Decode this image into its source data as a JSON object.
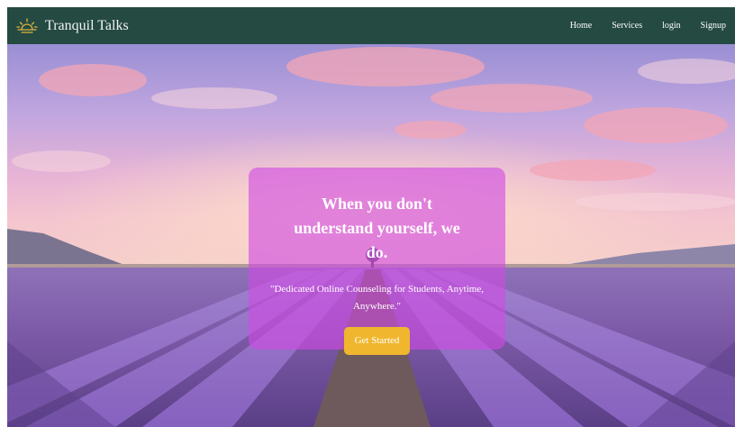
{
  "navbar": {
    "brand_name": "Tranquil Talks",
    "links": [
      "Home",
      "Services",
      "login",
      "Signup"
    ]
  },
  "hero": {
    "heading": "When you don't understand yourself, we do.",
    "subtext": "\"Dedicated Online Counseling for Students, Anytime, Anywhere.\"",
    "cta_label": "Get Started"
  },
  "colors": {
    "navbar_bg": "#244a42",
    "card_bg": "#d14ae4",
    "cta_bg": "#f0b62e",
    "brand_icon": "#e0b340"
  },
  "icons": {
    "brand": "sunrise-icon"
  }
}
